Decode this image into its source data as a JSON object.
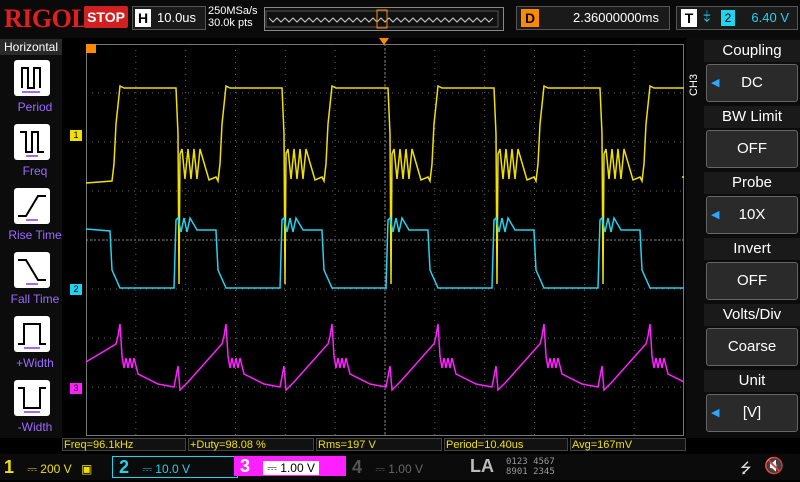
{
  "brand": "RIGOL",
  "run_state": "STOP",
  "horizontal": {
    "letter": "H",
    "scale": "10.0us"
  },
  "sample": {
    "rate": "250MSa/s",
    "points": "30.0k pts"
  },
  "delay": {
    "letter": "D",
    "value": "2.36000000ms"
  },
  "trigger": {
    "letter": "T",
    "source": "2",
    "level": "6.40 V"
  },
  "left_menu": {
    "title": "Horizontal",
    "items": [
      {
        "label": "Period",
        "icon": "period-icon"
      },
      {
        "label": "Freq",
        "icon": "freq-icon"
      },
      {
        "label": "Rise Time",
        "icon": "rise-time-icon"
      },
      {
        "label": "Fall Time",
        "icon": "fall-time-icon"
      },
      {
        "label": "+Width",
        "icon": "positive-width-icon"
      },
      {
        "label": "-Width",
        "icon": "negative-width-icon"
      }
    ]
  },
  "channel_menu": {
    "tag": "CH3",
    "items": [
      {
        "title": "Coupling",
        "value": "DC"
      },
      {
        "title": "BW Limit",
        "value": "OFF"
      },
      {
        "title": "Probe",
        "value": "10X"
      },
      {
        "title": "Invert",
        "value": "OFF"
      },
      {
        "title": "Volts/Div",
        "value": "Coarse"
      },
      {
        "title": "Unit",
        "value": "[V]"
      }
    ]
  },
  "measurements": [
    "Freq=96.1kHz",
    "+Duty=98.08 %",
    "Rms=197 V",
    "Period=10.40us",
    "Avg=167mV"
  ],
  "channels": [
    {
      "num": "1",
      "scale": "200 V",
      "color": "#f0e000"
    },
    {
      "num": "2",
      "scale": "10.0 V",
      "color": "#22d3ee"
    },
    {
      "num": "3",
      "scale": "1.00 V",
      "color": "#ff20ff"
    },
    {
      "num": "4",
      "scale": "1.00 V",
      "color": "#3a6cff"
    }
  ],
  "la": {
    "label": "LA",
    "bits_top": "0123 4567",
    "bits_bottom": "8901 2345"
  },
  "markers": {
    "ch1": "1",
    "ch2": "2",
    "ch3": "3"
  },
  "colors": {
    "ch1": "#f0e000",
    "ch2": "#22d3ee",
    "ch3": "#ff20ff",
    "ch4": "#3a6cff",
    "trigger": "#ff8a00"
  }
}
